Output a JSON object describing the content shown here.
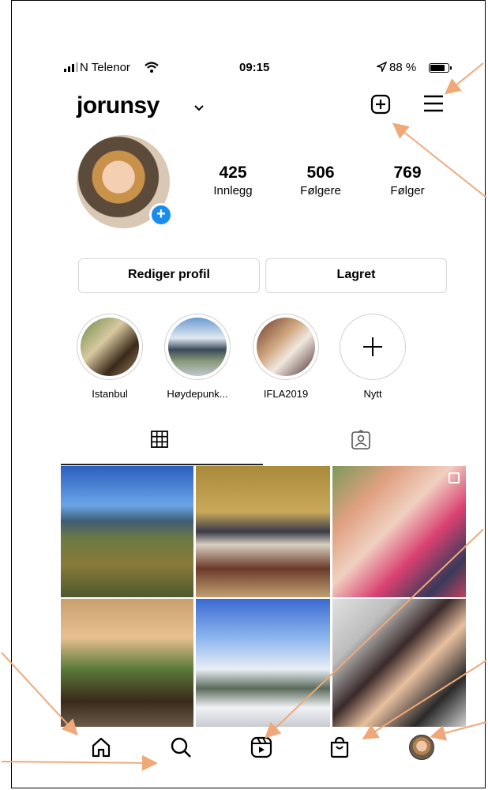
{
  "status_bar": {
    "carrier": "N Telenor",
    "time": "09:15",
    "battery": "88 %",
    "battery_level_percent": 88,
    "icons": [
      "signal-icon",
      "wifi-icon",
      "location-arrow-icon",
      "battery-icon"
    ]
  },
  "header": {
    "username": "jorunsy",
    "icons": [
      "chevron-down-icon",
      "new-post-icon",
      "menu-icon"
    ]
  },
  "profile": {
    "stats": [
      {
        "number": "425",
        "label": "Innlegg"
      },
      {
        "number": "506",
        "label": "Følgere"
      },
      {
        "number": "769",
        "label": "Følger"
      }
    ],
    "edit_button": "Rediger profil",
    "saved_button": "Lagret"
  },
  "highlights": [
    {
      "label": "Istanbul"
    },
    {
      "label": "Høydepunk..."
    },
    {
      "label": "IFLA2019"
    },
    {
      "label": "Nytt"
    }
  ],
  "tabs": {
    "icons": [
      "grid-icon",
      "tagged-icon"
    ],
    "active": "grid-icon"
  },
  "bottom_nav": {
    "icons": [
      "home-icon",
      "search-icon",
      "reels-icon",
      "shop-icon",
      "profile-avatar"
    ]
  },
  "colors": {
    "accent_blue": "#1a8cf0",
    "annotation_arrow": "#f0a878",
    "border_gray": "#d6d6d6"
  }
}
